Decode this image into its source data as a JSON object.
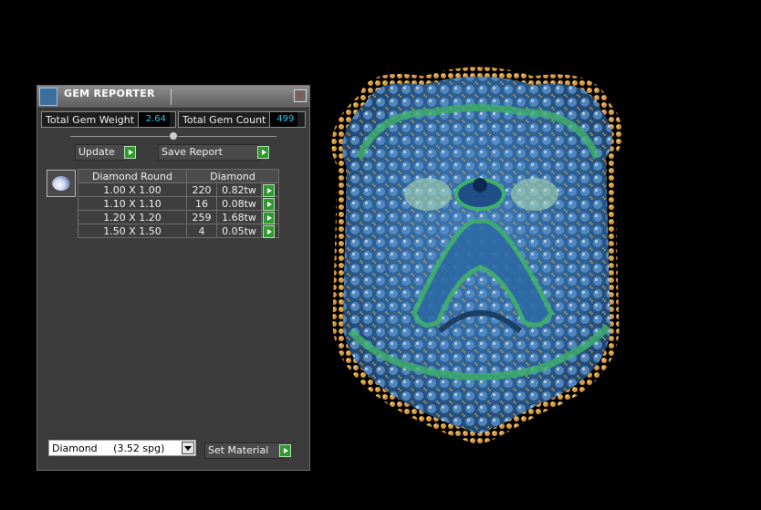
{
  "panel": {
    "title": "GEM REPORTER",
    "close_symbol": "×",
    "total_weight_label": "Total Gem Weight",
    "total_weight_value": "2.64",
    "total_count_label": "Total Gem Count",
    "total_count_value": "499",
    "update_label": "Update",
    "save_report_label": "Save Report",
    "table": {
      "headers": [
        "Diamond Round",
        "Diamond"
      ],
      "rows": [
        {
          "size": "1.00 X 1.00",
          "count": "220",
          "weight": "0.82tw"
        },
        {
          "size": "1.10 X 1.10",
          "count": "16",
          "weight": "0.08tw"
        },
        {
          "size": "1.20 X 1.20",
          "count": "259",
          "weight": "1.68tw"
        },
        {
          "size": "1.50 X 1.50",
          "count": "4",
          "weight": "0.05tw"
        }
      ]
    },
    "material_select": "Diamond     (3.52 spg)",
    "set_material_label": "Set Material"
  },
  "icons": {
    "title": "gem-reporter-app-icon",
    "gem": "diamond-oval-gem-icon",
    "play": "play-arrow-icon"
  },
  "colors": {
    "value_text": "#33bfe6",
    "play_button": "#2f9a2f",
    "badge_gold": "#c79a3a",
    "badge_blue": "#2d5d9a",
    "badge_green": "#3fb06a"
  }
}
